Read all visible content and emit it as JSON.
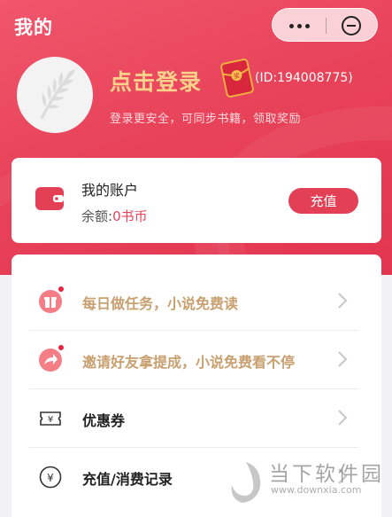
{
  "header": {
    "title": "我的",
    "more_icon": "more-dots-icon",
    "close_icon": "close-circle-icon",
    "bg_color": "#e8435a"
  },
  "profile": {
    "login_text": "点击登录",
    "user_id": "(ID:194008775)",
    "subtitle": "登录更安全，可同步书籍，领取奖励",
    "login_color": "#f8d28a"
  },
  "account": {
    "title": "我的账户",
    "balance_label": "余额:",
    "balance_value": "0书币",
    "recharge_label": "充值",
    "accent_color": "#e33f55"
  },
  "menu": {
    "items": [
      {
        "label": "每日做任务，小说免费读",
        "icon": "gift-icon",
        "badge": true
      },
      {
        "label": "邀请好友拿提成，小说免费看不停",
        "icon": "share-icon",
        "badge": true
      },
      {
        "label": "优惠券",
        "icon": "coupon-icon",
        "badge": false
      },
      {
        "label": "充值/消费记录",
        "icon": "yuan-icon",
        "badge": false
      }
    ]
  },
  "watermark": {
    "text": "当下软件园",
    "url": "www.downxia.com"
  }
}
